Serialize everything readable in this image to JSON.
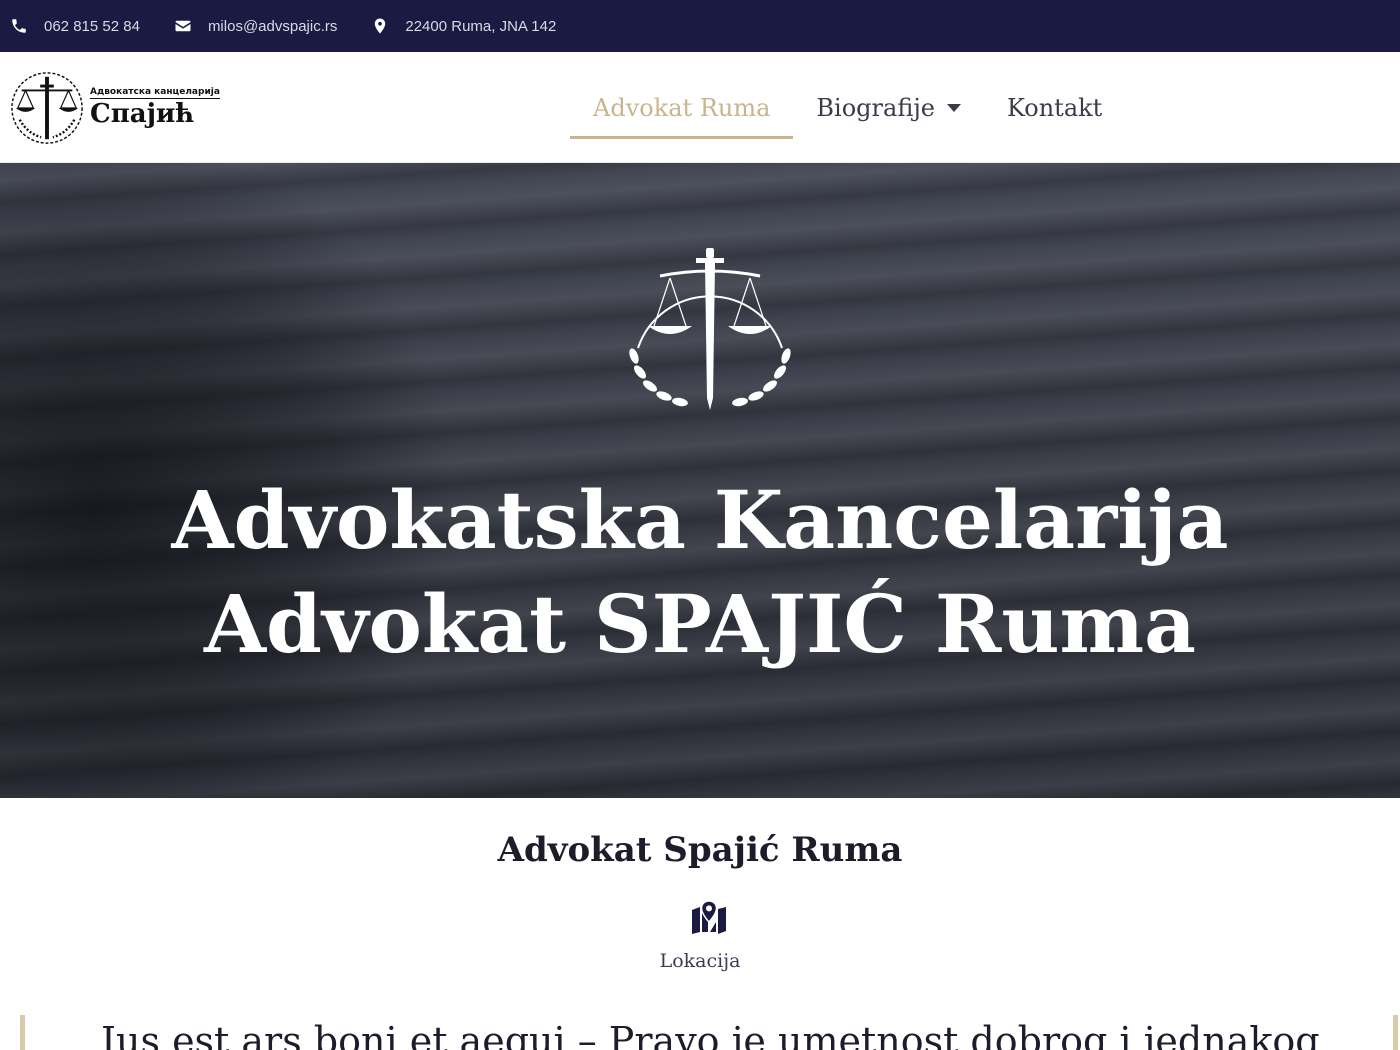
{
  "topbar": {
    "phone": "062 815 52 84",
    "email": "milos@advspajic.rs",
    "address": "22400 Ruma, JNA 142"
  },
  "logo": {
    "small_text": "Адвокатска канцеларија",
    "big_text": "Спајић"
  },
  "nav": {
    "items": [
      {
        "label": "Advokat Ruma",
        "active": true
      },
      {
        "label": "Biografije",
        "dropdown": true
      },
      {
        "label": "Kontakt"
      }
    ]
  },
  "hero": {
    "title_line1": "Advokatska Kancelarija",
    "title_line2": "Advokat SPAJIĆ Ruma"
  },
  "main": {
    "section_title": "Advokat Spajić Ruma",
    "location_label": "Lokacija",
    "quote": "Ius est ars boni et aequi – Pravo je umetnost dobrog i jednakog"
  },
  "colors": {
    "topbar_bg": "#1b1a43",
    "accent_gold": "#c9b48d",
    "icon_navy": "#1b1a43"
  }
}
